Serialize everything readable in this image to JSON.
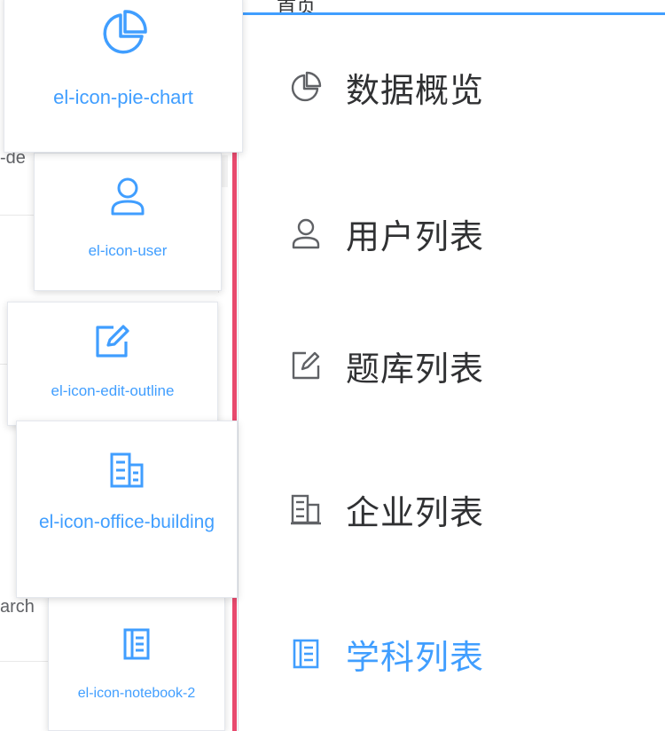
{
  "backdrop": {
    "fragment_top": "-de",
    "fragment_mid": "arch"
  },
  "cards": [
    {
      "icon": "pie-chart-icon",
      "label": "el-icon-pie-chart"
    },
    {
      "icon": "user-icon",
      "label": "el-icon-user"
    },
    {
      "icon": "edit-outline-icon",
      "label": "el-icon-edit-outline"
    },
    {
      "icon": "office-building-icon",
      "label": "el-icon-office-building"
    },
    {
      "icon": "notebook-icon",
      "label": "el-icon-notebook-2"
    }
  ],
  "menu": {
    "header_fragment": "首页",
    "items": [
      {
        "icon": "pie-chart-icon",
        "label": "数据概览",
        "active": false
      },
      {
        "icon": "user-icon",
        "label": "用户列表",
        "active": false
      },
      {
        "icon": "edit-outline-icon",
        "label": "题库列表",
        "active": false
      },
      {
        "icon": "office-building-icon",
        "label": "企业列表",
        "active": false
      },
      {
        "icon": "notebook-icon",
        "label": "学科列表",
        "active": true
      }
    ]
  },
  "colors": {
    "accent": "#409eff",
    "text": "#303133",
    "red_strip": "#e84a6e"
  }
}
